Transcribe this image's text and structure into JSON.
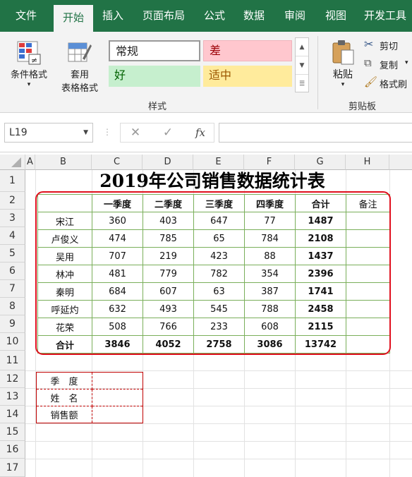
{
  "tabs": [
    "文件",
    "开始",
    "插入",
    "页面布局",
    "公式",
    "数据",
    "审阅",
    "视图",
    "开发工具"
  ],
  "ribbon": {
    "conditional_format": "条件格式",
    "format_as_table_1": "套用",
    "format_as_table_2": "表格格式",
    "styles": [
      "常规",
      "差",
      "好",
      "适中"
    ],
    "styles_group": "样式",
    "paste": "粘贴",
    "cut": "剪切",
    "copy": "复制",
    "format_painter": "格式刷",
    "clipboard_group": "剪贴板"
  },
  "formula_bar": {
    "name_box": "L19",
    "cancel": "✕",
    "confirm": "✓",
    "fx": "fx"
  },
  "columns": [
    "A",
    "B",
    "C",
    "D",
    "E",
    "F",
    "G",
    "H"
  ],
  "rows": [
    "1",
    "2",
    "3",
    "4",
    "5",
    "6",
    "7",
    "8",
    "9",
    "10",
    "11",
    "12",
    "13",
    "14",
    "15",
    "16",
    "17"
  ],
  "sheet": {
    "title": "2019年公司销售数据统计表",
    "header": [
      "",
      "一季度",
      "二季度",
      "三季度",
      "四季度",
      "合计",
      "备注"
    ],
    "records": [
      {
        "name": "宋江",
        "q": [
          "360",
          "403",
          "647",
          "77"
        ],
        "total": "1487",
        "note": ""
      },
      {
        "name": "卢俊义",
        "q": [
          "474",
          "785",
          "65",
          "784"
        ],
        "total": "2108",
        "note": ""
      },
      {
        "name": "吴用",
        "q": [
          "707",
          "219",
          "423",
          "88"
        ],
        "total": "1437",
        "note": ""
      },
      {
        "name": "林冲",
        "q": [
          "481",
          "779",
          "782",
          "354"
        ],
        "total": "2396",
        "note": ""
      },
      {
        "name": "秦明",
        "q": [
          "684",
          "607",
          "63",
          "387"
        ],
        "total": "1741",
        "note": ""
      },
      {
        "name": "呼延灼",
        "q": [
          "632",
          "493",
          "545",
          "788"
        ],
        "total": "2458",
        "note": ""
      },
      {
        "name": "花荣",
        "q": [
          "508",
          "766",
          "233",
          "608"
        ],
        "total": "2115",
        "note": ""
      }
    ],
    "totals": {
      "label": "合计",
      "q": [
        "3846",
        "4052",
        "2758",
        "3086"
      ],
      "total": "13742",
      "note": ""
    },
    "lookup": [
      {
        "label": "季　度",
        "value": ""
      },
      {
        "label": "姓　名",
        "value": ""
      },
      {
        "label": "销售额",
        "value": ""
      }
    ]
  },
  "colors": {
    "excel_green": "#217346",
    "table_border": "#7aaf5a",
    "highlight_red": "#e0101e"
  }
}
